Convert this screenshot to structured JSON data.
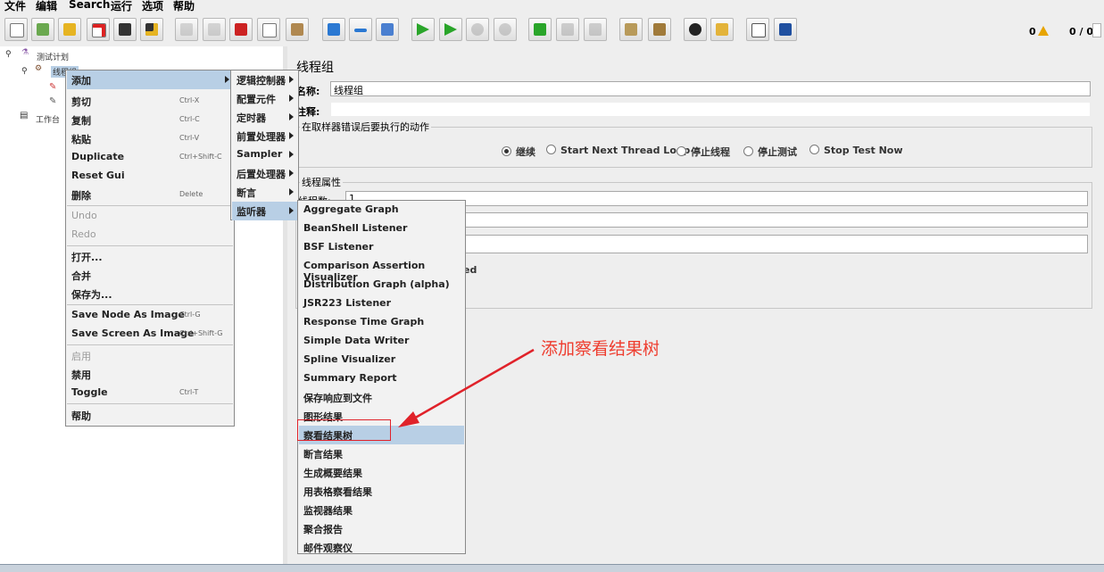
{
  "menubar": [
    "文件",
    "编辑",
    "Search",
    "运行",
    "选项",
    "帮助"
  ],
  "toolbar": {
    "icons": [
      "new-icon",
      "templates-icon",
      "open-icon",
      "close-icon",
      "save-icon",
      "save-as-icon",
      "undo-icon",
      "redo-icon",
      "cut-icon",
      "copy-icon",
      "paste-icon",
      "expand-icon",
      "collapse-icon",
      "toggle-icon",
      "start-icon",
      "start-no-pause-icon",
      "stop-icon",
      "shutdown-icon",
      "remote-start-icon",
      "remote-stop-icon",
      "remote-shutdown-icon",
      "clear-icon",
      "clear-all-icon",
      "search-icon",
      "reset-search-icon",
      "function-helper-icon",
      "help-icon"
    ],
    "error_count": "0",
    "thread_count": "0 / 0"
  },
  "tree": {
    "test_plan": "测试计划",
    "thread_group": "线程组",
    "workbench": "工作台"
  },
  "right": {
    "title": "线程组",
    "name_label": "名称:",
    "name_value": "线程组",
    "comment_label": "注释:",
    "error_action_title": "在取样器错误后要执行的动作",
    "radios": [
      "继续",
      "Start Next Thread Loop",
      "停止线程",
      "停止测试",
      "Stop Test Now"
    ],
    "thread_props_title": "线程属性",
    "thread_count_label": "线程数:",
    "thread_count_value": "1",
    "partial_text": "ed"
  },
  "context_menu": {
    "add": "添加",
    "cut": "剪切",
    "cut_key": "Ctrl-X",
    "copy": "复制",
    "copy_key": "Ctrl-C",
    "paste": "粘贴",
    "paste_key": "Ctrl-V",
    "duplicate": "Duplicate",
    "duplicate_key": "Ctrl+Shift-C",
    "reset_gui": "Reset Gui",
    "delete": "删除",
    "delete_key": "Delete",
    "undo": "Undo",
    "redo": "Redo",
    "open": "打开...",
    "merge": "合并",
    "save_as": "保存为...",
    "save_node_image": "Save Node As Image",
    "save_node_key": "Ctrl-G",
    "save_screen_image": "Save Screen As Image",
    "save_screen_key": "Ctrl+Shift-G",
    "enable": "启用",
    "disable": "禁用",
    "toggle": "Toggle",
    "toggle_key": "Ctrl-T",
    "help": "帮助"
  },
  "add_submenu": [
    "逻辑控制器",
    "配置元件",
    "定时器",
    "前置处理器",
    "Sampler",
    "后置处理器",
    "断言",
    "监听器"
  ],
  "listener_submenu": [
    "Aggregate Graph",
    "BeanShell Listener",
    "BSF Listener",
    "Comparison Assertion Visualizer",
    "Distribution Graph (alpha)",
    "JSR223 Listener",
    "Response Time Graph",
    "Simple Data Writer",
    "Spline Visualizer",
    "Summary Report",
    "保存响应到文件",
    "图形结果",
    "察看结果树",
    "断言结果",
    "生成概要结果",
    "用表格察看结果",
    "监视器结果",
    "聚合报告",
    "邮件观察仪"
  ],
  "annotation": "添加察看结果树",
  "colors": {
    "highlight": "#b8cfe5",
    "annotation": "#ee3d2f",
    "menu_bg": "#f2f2f2"
  }
}
